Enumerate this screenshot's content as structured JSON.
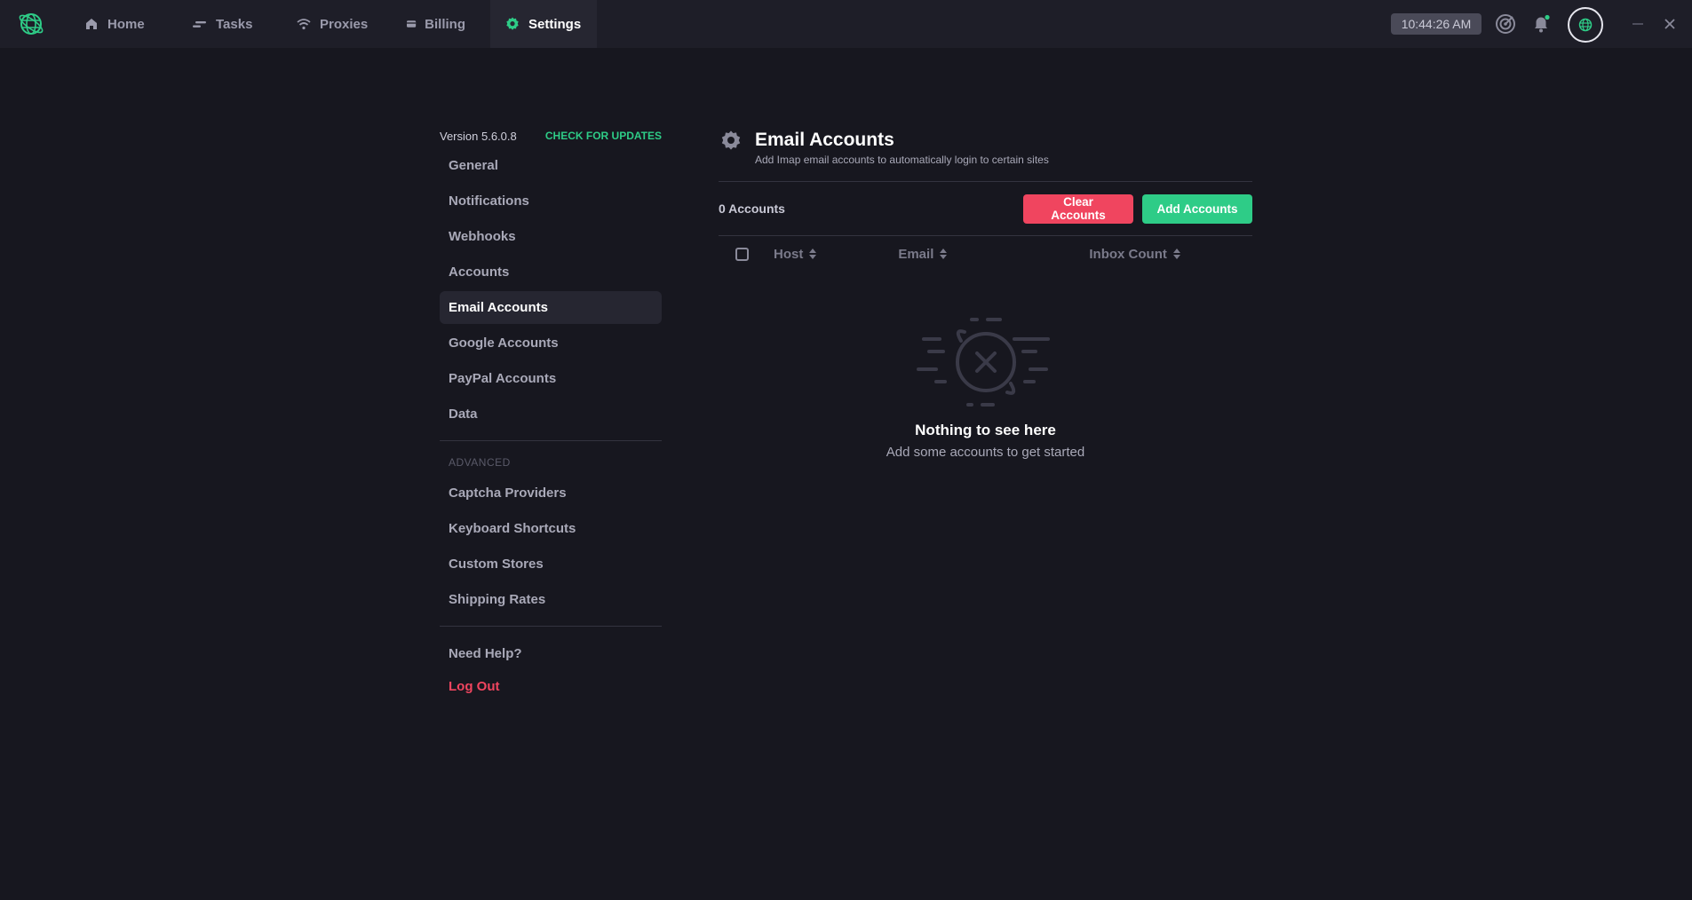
{
  "topbar": {
    "nav": [
      {
        "label": "Home",
        "icon": "home-icon"
      },
      {
        "label": "Tasks",
        "icon": "tasks-icon"
      },
      {
        "label": "Proxies",
        "icon": "wifi-icon"
      },
      {
        "label": "Billing",
        "icon": "card-icon"
      },
      {
        "label": "Settings",
        "icon": "gear-icon"
      }
    ],
    "active_tab": "Settings",
    "clock": "10:44:26 AM"
  },
  "sidebar": {
    "version": "Version 5.6.0.8",
    "check_updates": "CHECK FOR UPDATES",
    "items": [
      "General",
      "Notifications",
      "Webhooks",
      "Accounts",
      "Email Accounts",
      "Google Accounts",
      "PayPal Accounts",
      "Data"
    ],
    "active_item": "Email Accounts",
    "advanced_label": "ADVANCED",
    "advanced_items": [
      "Captcha Providers",
      "Keyboard Shortcuts",
      "Custom Stores",
      "Shipping Rates"
    ],
    "help": "Need Help?",
    "logout": "Log Out"
  },
  "main": {
    "title": "Email Accounts",
    "subtitle": "Add Imap email accounts to automatically login to certain sites",
    "count": "0 Accounts",
    "clear_button": "Clear Accounts",
    "add_button": "Add Accounts",
    "columns": [
      "Host",
      "Email",
      "Inbox Count"
    ],
    "empty_title": "Nothing to see here",
    "empty_subtitle": "Add some accounts to get started"
  },
  "colors": {
    "accent": "#2ecc87",
    "danger": "#f0455f",
    "background": "#17171f",
    "topbar": "#1e1e28"
  }
}
